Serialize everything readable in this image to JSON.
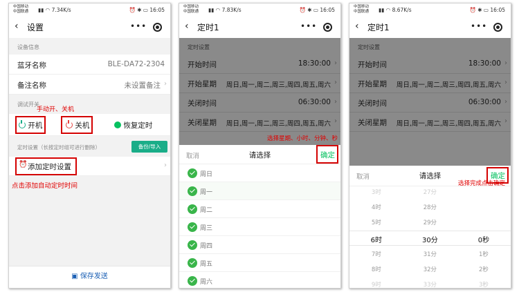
{
  "status": {
    "carrier1": "中国移动",
    "carrier2": "中国联通",
    "time": "16:05",
    "p1_speed": "7.34K/s",
    "p2_speed": "7.83K/s",
    "p3_speed": "8.67K/s"
  },
  "screen1": {
    "title": "设置",
    "section_device": "设备信息",
    "bt_label": "蓝牙名称",
    "bt_value": "BLE-DA72-2304",
    "note_label": "备注名称",
    "note_value": "未设置备注",
    "section_debug": "调试开关",
    "annotation_manual": "手动开、关机",
    "on_label": "开机",
    "off_label": "关机",
    "restore_label": "恢复定时",
    "section_timer": "定时设置（长按定时组可进行删除）",
    "backup_label": "备份/导入",
    "add_timer_label": "添加定时设置",
    "annotation_add": "点击添加自动定时时间",
    "save_label": "保存发送"
  },
  "screen2": {
    "title": "定时1",
    "section": "定时设置",
    "start_time_label": "开始时间",
    "start_time_value": "18:30:00",
    "start_week_label": "开始星期",
    "start_week_value": "周日,周一,周二,周三,周四,周五,周六",
    "close_time_label": "关闭时间",
    "close_time_value": "06:30:00",
    "close_week_label": "关闭星期",
    "close_week_value": "周日,周一,周二,周三,周四,周五,周六",
    "annotation": "选择星期、小时、分钟、秒",
    "cancel": "取消",
    "picker_title": "请选择",
    "confirm": "确定",
    "days": [
      "周日",
      "周一",
      "周二",
      "周三",
      "周四",
      "周五",
      "周六"
    ]
  },
  "screen3": {
    "title": "定时1",
    "section": "定时设置",
    "start_time_label": "开始时间",
    "start_time_value": "18:30:00",
    "start_week_label": "开始星期",
    "start_week_value": "周日,周一,周二,周三,周四,周五,周六",
    "close_time_label": "关闭时间",
    "close_time_value": "06:30:00",
    "close_week_label": "关闭星期",
    "close_week_value": "周日,周一,周二,周三,周四,周五,周六",
    "cancel": "取消",
    "picker_title": "请选择",
    "confirm": "确定",
    "annotation": "选择完成点击确定",
    "hours": [
      "3时",
      "4时",
      "5时",
      "6时",
      "7时",
      "8时",
      "9时"
    ],
    "minutes": [
      "27分",
      "28分",
      "29分",
      "30分",
      "31分",
      "32分",
      "33分"
    ],
    "seconds": [
      "",
      "",
      "",
      "0秒",
      "1秒",
      "2秒",
      "3秒"
    ]
  },
  "colors": {
    "accent": "#07c160",
    "annotation": "#e00000",
    "backup": "#1aad88",
    "save": "#1a5fb4"
  }
}
